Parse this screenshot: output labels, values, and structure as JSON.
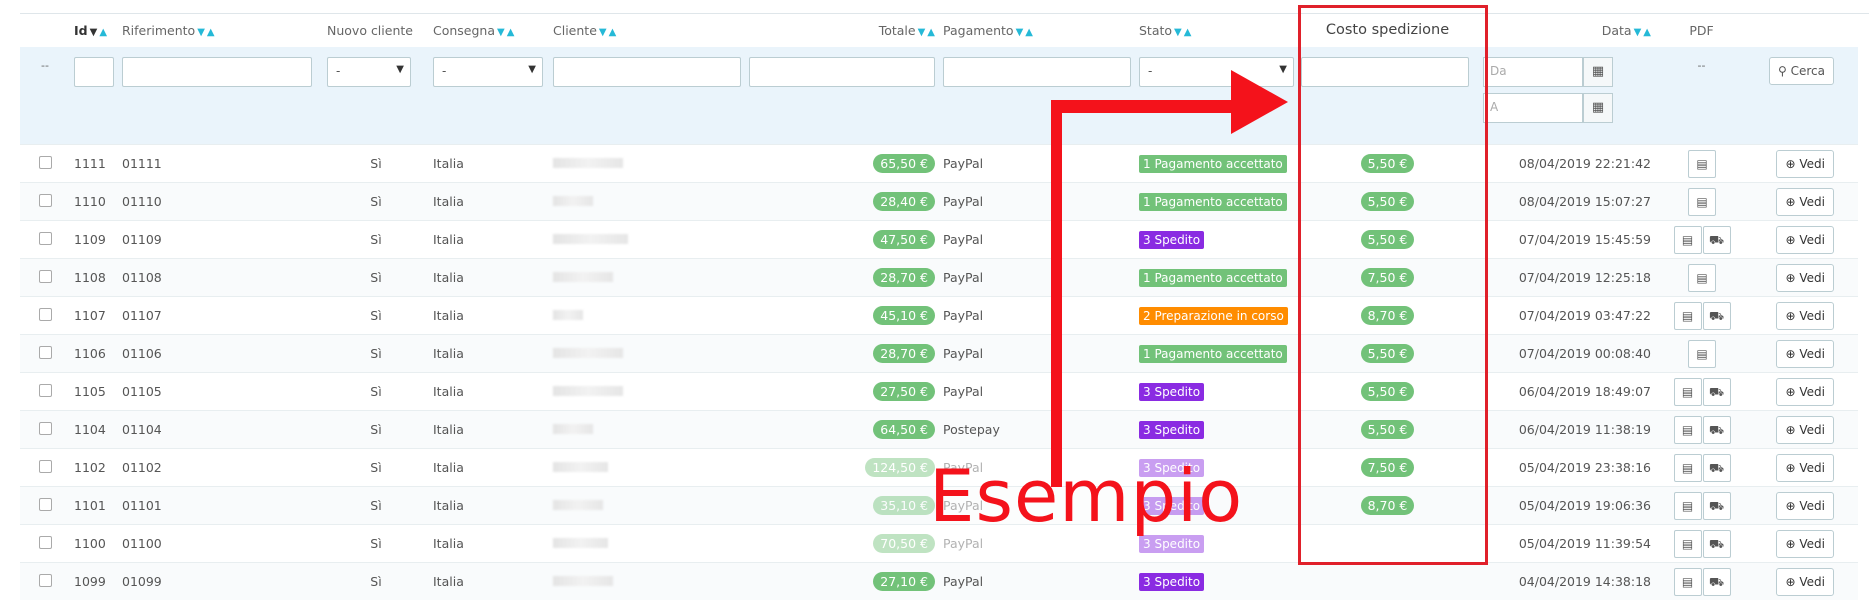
{
  "headers": {
    "id": "Id",
    "riferimento": "Riferimento",
    "nuovo_cliente": "Nuovo cliente",
    "consegna": "Consegna",
    "cliente": "Cliente",
    "totale": "Totale",
    "pagamento": "Pagamento",
    "stato": "Stato",
    "costo_spedizione": "Costo spedizione",
    "data": "Data",
    "pdf": "PDF"
  },
  "filters": {
    "dash": "--",
    "select_default": "-",
    "date_from_placeholder": "Da",
    "date_to_placeholder": "A",
    "pdf_dash": "--",
    "search_button": "Cerca"
  },
  "annotation": {
    "label": "Esempio",
    "color": "#f4121b"
  },
  "colors": {
    "green": "#72c279",
    "purple": "#8a2be2",
    "orange": "#ff8c00",
    "accent": "#25b9d7"
  },
  "rows": [
    {
      "id": "1111",
      "ref": "01111",
      "nuovo": "Sì",
      "consegna": "Italia",
      "totale": "65,50 €",
      "pagamento": "PayPal",
      "stato": "1 Pagamento accettato",
      "stato_color": "green",
      "costo": "5,50 €",
      "data": "08/04/2019 22:21:42",
      "pdf": [
        "invoice"
      ]
    },
    {
      "id": "1110",
      "ref": "01110",
      "nuovo": "Sì",
      "consegna": "Italia",
      "totale": "28,40 €",
      "pagamento": "PayPal",
      "stato": "1 Pagamento accettato",
      "stato_color": "green",
      "costo": "5,50 €",
      "data": "08/04/2019 15:07:27",
      "pdf": [
        "invoice"
      ]
    },
    {
      "id": "1109",
      "ref": "01109",
      "nuovo": "Sì",
      "consegna": "Italia",
      "totale": "47,50 €",
      "pagamento": "PayPal",
      "stato": "3 Spedito",
      "stato_color": "purple",
      "costo": "5,50 €",
      "data": "07/04/2019 15:45:59",
      "pdf": [
        "invoice",
        "delivery"
      ]
    },
    {
      "id": "1108",
      "ref": "01108",
      "nuovo": "Sì",
      "consegna": "Italia",
      "totale": "28,70 €",
      "pagamento": "PayPal",
      "stato": "1 Pagamento accettato",
      "stato_color": "green",
      "costo": "7,50 €",
      "data": "07/04/2019 12:25:18",
      "pdf": [
        "invoice"
      ]
    },
    {
      "id": "1107",
      "ref": "01107",
      "nuovo": "Sì",
      "consegna": "Italia",
      "totale": "45,10 €",
      "pagamento": "PayPal",
      "stato": "2 Preparazione in corso",
      "stato_color": "orange",
      "costo": "8,70 €",
      "data": "07/04/2019 03:47:22",
      "pdf": [
        "invoice",
        "delivery"
      ]
    },
    {
      "id": "1106",
      "ref": "01106",
      "nuovo": "Sì",
      "consegna": "Italia",
      "totale": "28,70 €",
      "pagamento": "PayPal",
      "stato": "1 Pagamento accettato",
      "stato_color": "green",
      "costo": "5,50 €",
      "data": "07/04/2019 00:08:40",
      "pdf": [
        "invoice"
      ]
    },
    {
      "id": "1105",
      "ref": "01105",
      "nuovo": "Sì",
      "consegna": "Italia",
      "totale": "27,50 €",
      "pagamento": "PayPal",
      "stato": "3 Spedito",
      "stato_color": "purple",
      "costo": "5,50 €",
      "data": "06/04/2019 18:49:07",
      "pdf": [
        "invoice",
        "delivery"
      ]
    },
    {
      "id": "1104",
      "ref": "01104",
      "nuovo": "Sì",
      "consegna": "Italia",
      "totale": "64,50 €",
      "pagamento": "Postepay",
      "stato": "3 Spedito",
      "stato_color": "purple",
      "costo": "5,50 €",
      "data": "06/04/2019 11:38:19",
      "pdf": [
        "invoice",
        "delivery"
      ]
    },
    {
      "id": "1102",
      "ref": "01102",
      "nuovo": "Sì",
      "consegna": "Italia",
      "totale": "124,50 €",
      "pagamento": "PayPal",
      "stato": "3 Spedito",
      "stato_color": "purple",
      "costo": "7,50 €",
      "data": "05/04/2019 23:38:16",
      "pdf": [
        "invoice",
        "delivery"
      ]
    },
    {
      "id": "1101",
      "ref": "01101",
      "nuovo": "Sì",
      "consegna": "Italia",
      "totale": "35,10 €",
      "pagamento": "PayPal",
      "stato": "3 Spedito",
      "stato_color": "purple",
      "costo": "8,70 €",
      "data": "05/04/2019 19:06:36",
      "pdf": [
        "invoice",
        "delivery"
      ]
    },
    {
      "id": "1100",
      "ref": "01100",
      "nuovo": "Sì",
      "consegna": "Italia",
      "totale": "70,50 €",
      "pagamento": "PayPal",
      "stato": "3 Spedito",
      "stato_color": "purple",
      "costo": "",
      "data": "05/04/2019 11:39:54",
      "pdf": [
        "invoice",
        "delivery"
      ]
    },
    {
      "id": "1099",
      "ref": "01099",
      "nuovo": "Sì",
      "consegna": "Italia",
      "totale": "27,10 €",
      "pagamento": "PayPal",
      "stato": "3 Spedito",
      "stato_color": "purple",
      "costo": "",
      "data": "04/04/2019 14:38:18",
      "pdf": [
        "invoice",
        "delivery"
      ]
    }
  ],
  "row_action": "Vedi"
}
